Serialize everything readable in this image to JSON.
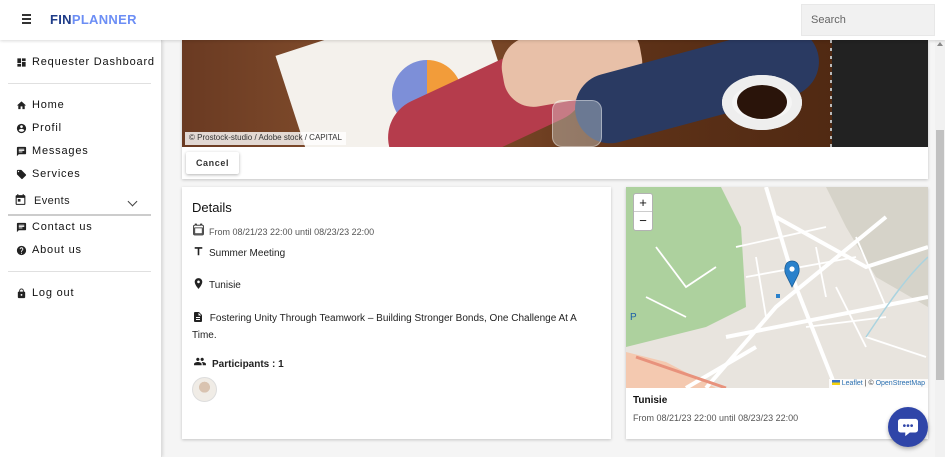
{
  "app": {
    "logo_part1": "FIN",
    "logo_part2": "PLANNER"
  },
  "search": {
    "placeholder": "Search"
  },
  "sidebar": {
    "items": [
      {
        "label": "Requester Dashboard",
        "icon": "dashboard-icon"
      },
      {
        "label": "Home",
        "icon": "home-icon"
      },
      {
        "label": "Profil",
        "icon": "account-circle-icon"
      },
      {
        "label": "Messages",
        "icon": "chat-icon"
      },
      {
        "label": "Services",
        "icon": "tag-icon"
      },
      {
        "label": "Events",
        "icon": "calendar-icon",
        "expandable": true
      },
      {
        "label": "Contact us",
        "icon": "chat-icon"
      },
      {
        "label": "About us",
        "icon": "help-circle-icon"
      },
      {
        "label": "Log out",
        "icon": "lock-icon"
      }
    ]
  },
  "banner": {
    "credit": "© Prostock-studio / Adobe stock / CAPITAL",
    "cancel_label": "Cancel"
  },
  "details": {
    "title": "Details",
    "dates": "From 08/21/23 22:00 until 08/23/23 22:00",
    "name": "Summer Meeting",
    "location": "Tunisie",
    "description": "Fostering Unity Through Teamwork – Building Stronger Bonds, One Challenge At A Time.",
    "participants_label": "Participants : 1"
  },
  "map": {
    "zoom_in": "+",
    "zoom_out": "−",
    "attribution_leaflet": "Leaflet",
    "attribution_sep": " | © ",
    "attribution_osm": "OpenStreetMap",
    "location": "Tunisie",
    "dates": "From 08/21/23 22:00 until 08/23/23 22:00"
  },
  "colors": {
    "brand_dark": "#1f3c88",
    "brand_light": "#6c8ef5",
    "chat_button": "#2f45a8",
    "map_marker": "#2a81cb"
  }
}
